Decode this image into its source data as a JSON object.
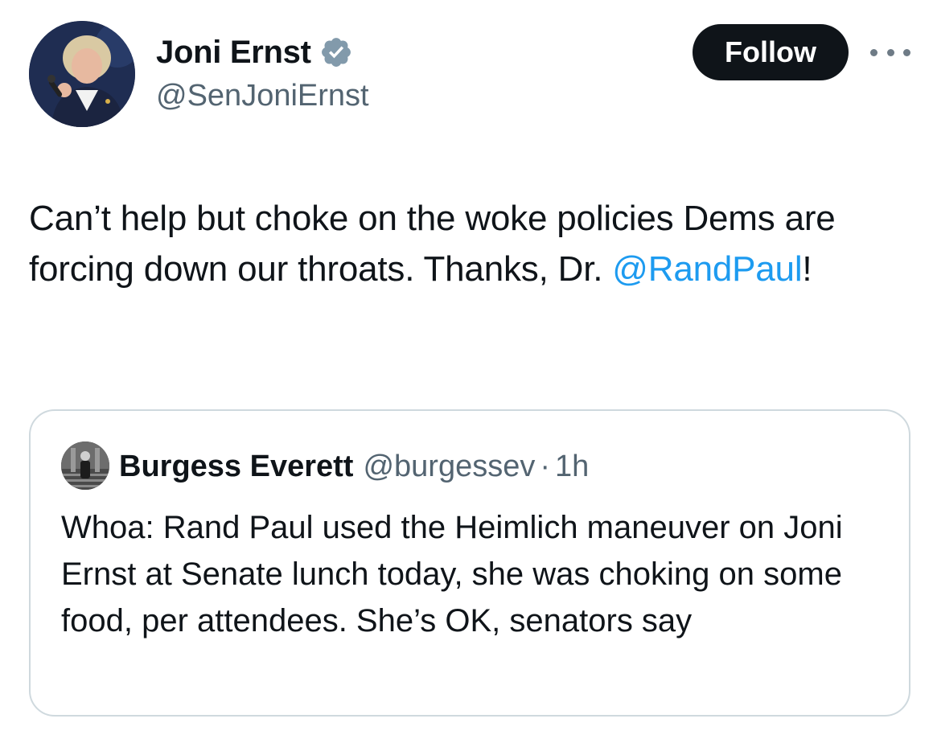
{
  "author": {
    "display_name": "Joni Ernst",
    "handle": "@SenJoniErnst",
    "verified_icon": "verified-badge-icon",
    "avatar": "author-avatar"
  },
  "actions": {
    "follow_label": "Follow",
    "more_icon": "more-options-icon"
  },
  "tweet": {
    "text_before_mention": "Can’t help but choke on the woke policies Dems are forcing down our throats. Thanks, Dr. ",
    "mention": "@RandPaul",
    "text_after_mention": "!"
  },
  "quoted_tweet": {
    "display_name": "Burgess Everett",
    "handle": "@burgessev",
    "separator": "·",
    "time": "1h",
    "text": "Whoa: Rand Paul used the Heimlich maneuver on Joni Ernst at Senate lunch today, she was choking on some food, per attendees. She’s OK, senators say"
  },
  "colors": {
    "text_primary": "#0f1419",
    "text_secondary": "#536471",
    "link": "#1d9bf0",
    "follow_bg": "#0f1419",
    "follow_text": "#ffffff",
    "card_border": "#cfd9de",
    "verified": "#829aab"
  }
}
